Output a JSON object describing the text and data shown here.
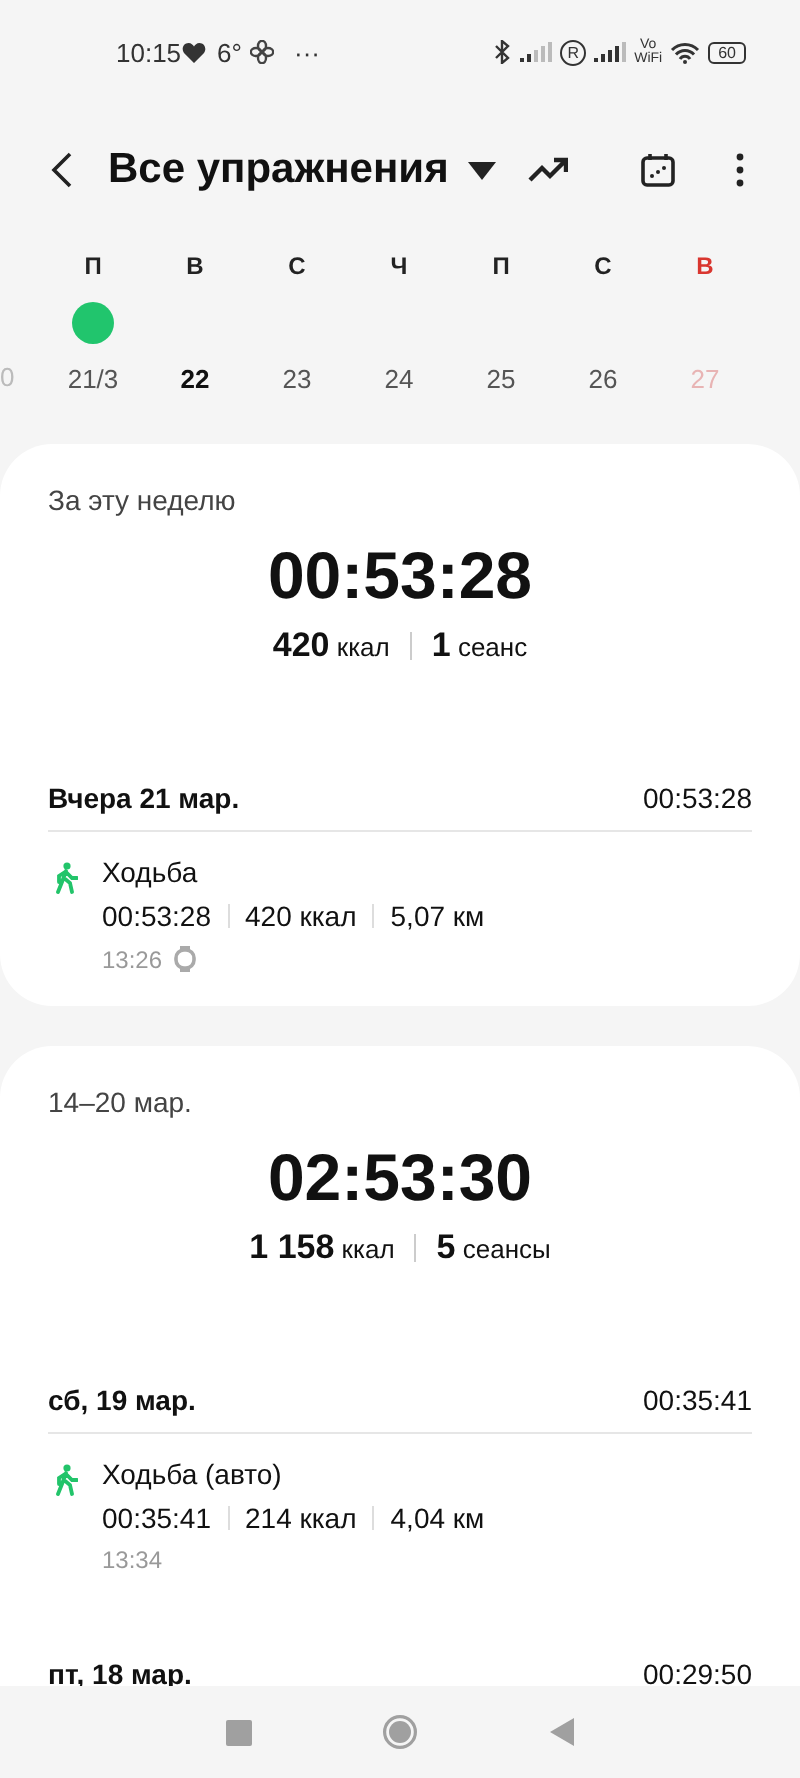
{
  "status_bar": {
    "time": "10:15",
    "temperature": "6°",
    "more": "···",
    "roaming": "R",
    "vowifi": "Vo WiFi",
    "battery": "60"
  },
  "header": {
    "title": "Все упражнения"
  },
  "week": {
    "days": [
      {
        "label": "П",
        "weekend": false
      },
      {
        "label": "В",
        "weekend": false
      },
      {
        "label": "С",
        "weekend": false
      },
      {
        "label": "Ч",
        "weekend": false
      },
      {
        "label": "П",
        "weekend": false
      },
      {
        "label": "С",
        "weekend": false
      },
      {
        "label": "В",
        "weekend": true
      }
    ],
    "prev_date": "0",
    "dates": [
      {
        "label": "21/3",
        "selected": false,
        "workout": true,
        "weekend": false
      },
      {
        "label": "22",
        "selected": true,
        "workout": false,
        "weekend": false
      },
      {
        "label": "23",
        "selected": false,
        "workout": false,
        "weekend": false
      },
      {
        "label": "24",
        "selected": false,
        "workout": false,
        "weekend": false
      },
      {
        "label": "25",
        "selected": false,
        "workout": false,
        "weekend": false
      },
      {
        "label": "26",
        "selected": false,
        "workout": false,
        "weekend": false
      },
      {
        "label": "27",
        "selected": false,
        "workout": false,
        "weekend": true
      }
    ]
  },
  "sections": [
    {
      "period": "За эту неделю",
      "duration": "00:53:28",
      "stats": [
        {
          "value": "420",
          "unit": "ккал"
        },
        {
          "value": "1",
          "unit": "сеанс"
        }
      ],
      "days": [
        {
          "date": "Вчера 21 мар.",
          "total": "00:53:28",
          "entries": [
            {
              "name": "Ходьба",
              "duration": "00:53:28",
              "calories": "420 ккал",
              "distance": "5,07 км",
              "time": "13:26",
              "watch": true
            }
          ]
        }
      ]
    },
    {
      "period": "14–20 мар.",
      "duration": "02:53:30",
      "stats": [
        {
          "value": "1 158",
          "unit": "ккал"
        },
        {
          "value": "5",
          "unit": "сеансы"
        }
      ],
      "days": [
        {
          "date": "сб, 19 мар.",
          "total": "00:35:41",
          "entries": [
            {
              "name": "Ходьба (авто)",
              "duration": "00:35:41",
              "calories": "214 ккал",
              "distance": "4,04 км",
              "time": "13:34",
              "watch": false
            }
          ]
        },
        {
          "date": "пт, 18 мар.",
          "total": "00:29:50"
        }
      ]
    }
  ]
}
